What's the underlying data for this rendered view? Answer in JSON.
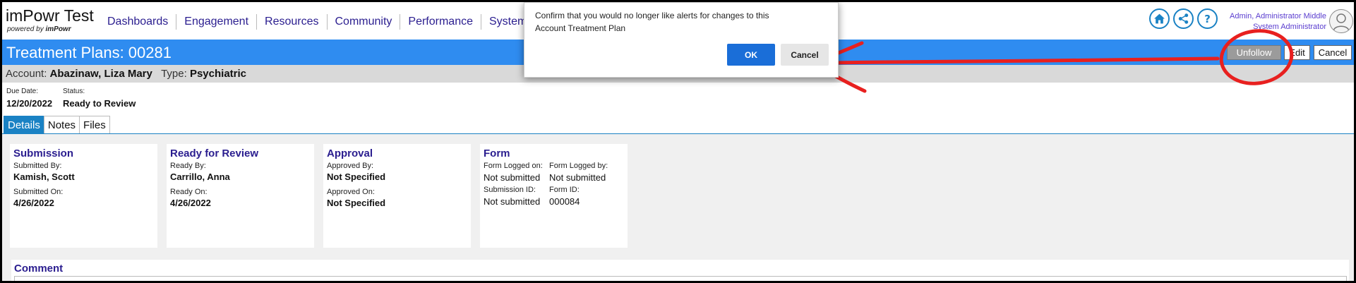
{
  "app": {
    "title": "imPowr Test",
    "powered_by_prefix": "powered by",
    "powered_by_brand": "imPowr"
  },
  "nav": [
    "Dashboards",
    "Engagement",
    "Resources",
    "Community",
    "Performance",
    "System"
  ],
  "header_icons": [
    "home-icon",
    "share-icon",
    "help-icon"
  ],
  "user": {
    "name": "Admin, Administrator Middle",
    "role": "System Administrator"
  },
  "titlebar": {
    "title": "Treatment Plans: 00281",
    "unfollow_label": "Unfollow",
    "edit_label": "Edit",
    "cancel_label": "Cancel"
  },
  "account": {
    "account_label": "Account:",
    "account_value": "Abazinaw, Liza Mary",
    "type_label": "Type:",
    "type_value": "Psychiatric"
  },
  "status": {
    "due_label": "Due Date:",
    "due_value": "12/20/2022",
    "status_label": "Status:",
    "status_value": "Ready to Review"
  },
  "tabs": [
    "Details",
    "Notes",
    "Files"
  ],
  "cards": {
    "submission": {
      "title": "Submission",
      "by_label": "Submitted By:",
      "by_value": "Kamish, Scott",
      "on_label": "Submitted On:",
      "on_value": "4/26/2022"
    },
    "review": {
      "title": "Ready for Review",
      "by_label": "Ready By:",
      "by_value": "Carrillo, Anna",
      "on_label": "Ready On:",
      "on_value": "4/26/2022"
    },
    "approval": {
      "title": "Approval",
      "by_label": "Approved By:",
      "by_value": "Not Specified",
      "on_label": "Approved On:",
      "on_value": "Not Specified"
    },
    "form": {
      "title": "Form",
      "logged_on_label": "Form Logged on:",
      "logged_on_value": "Not submitted",
      "logged_by_label": "Form Logged by:",
      "logged_by_value": "Not submitted",
      "submission_id_label": "Submission ID:",
      "submission_id_value": "Not submitted",
      "form_id_label": "Form ID:",
      "form_id_value": "000084"
    }
  },
  "comment": {
    "title": "Comment"
  },
  "dialog": {
    "message_line1": "Confirm that you would no longer like alerts for changes to this",
    "message_line2": "Account Treatment Plan",
    "ok_label": "OK",
    "cancel_label": "Cancel"
  },
  "colors": {
    "titlebar": "#2f8cf0",
    "nav_text": "#2a1d8f",
    "ok_button": "#1a6ed8",
    "annotation": "#e8201f"
  }
}
